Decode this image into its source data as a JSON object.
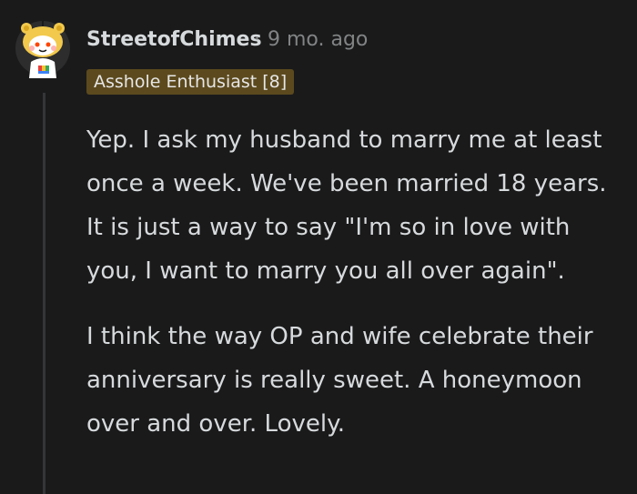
{
  "comment": {
    "author": "StreetofChimes",
    "separator": "·",
    "time_ago": "9 mo. ago",
    "flair": "Asshole Enthusiast [8]",
    "paragraphs": [
      "Yep. I ask my husband to marry me at least once a week. We've been married 18 years. It is just a way to say \"I'm so in love with you, I want to marry you all over again\".",
      "I think the way OP and wife celebrate their anniversary is really sweet. A honeymoon over and over. Lovely."
    ]
  },
  "colors": {
    "background": "#1a1a1b",
    "text": "#d7dadc",
    "muted": "#818384",
    "flair_bg": "#5c4a1e",
    "thread_line": "#343536"
  },
  "icons": {
    "avatar": "snoo-avatar-icon"
  }
}
